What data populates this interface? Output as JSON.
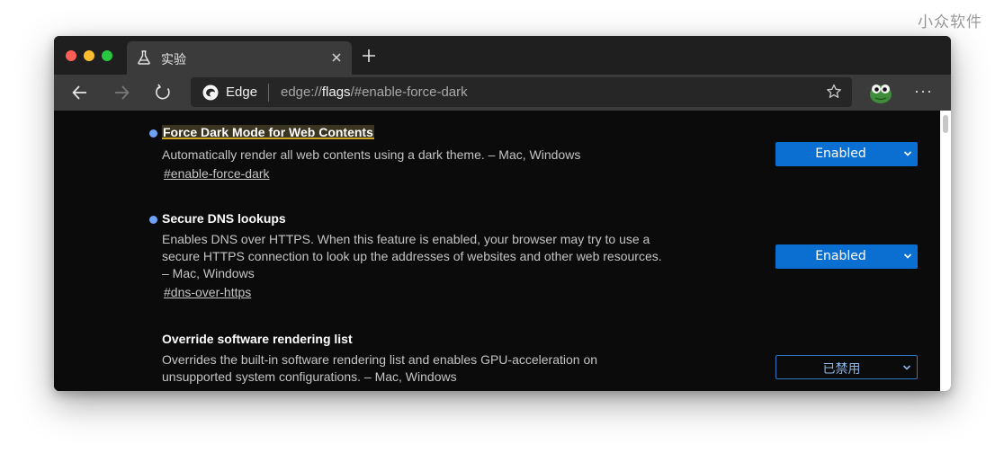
{
  "watermark": "小众软件",
  "tab": {
    "title": "实验",
    "icon": "beaker-icon",
    "close_icon": "close-icon"
  },
  "new_tab_icon": "plus-icon",
  "toolbar": {
    "back_icon": "back-arrow-icon",
    "forward_icon": "forward-arrow-icon",
    "refresh_icon": "refresh-icon",
    "site_name": "Edge",
    "url_prefix": "edge://",
    "url_host": "flags",
    "url_path": "/#enable-force-dark",
    "favorite_icon": "star-icon",
    "more_icon": "more-icon"
  },
  "flags": [
    {
      "title": "Force Dark Mode for Web Contents",
      "description": "Automatically render all web contents using a dark theme. – Mac, Windows",
      "link": "#enable-force-dark",
      "value": "Enabled",
      "modified": true
    },
    {
      "title": "Secure DNS lookups",
      "description": "Enables DNS over HTTPS. When this feature is enabled, your browser may try to use a secure HTTPS connection to look up the addresses of websites and other web resources. – Mac, Windows",
      "link": "#dns-over-https",
      "value": "Enabled",
      "modified": true
    },
    {
      "title": "Override software rendering list",
      "description": "Overrides the built-in software rendering list and enables GPU-acceleration on unsupported system configurations. – Mac, Windows",
      "value": "已禁用",
      "modified": false
    }
  ],
  "colors": {
    "accent": "#0a6fd1",
    "modified_dot": "#6fa3f7",
    "background": "#0b0b0b",
    "toolbar": "#3b3b3b"
  }
}
